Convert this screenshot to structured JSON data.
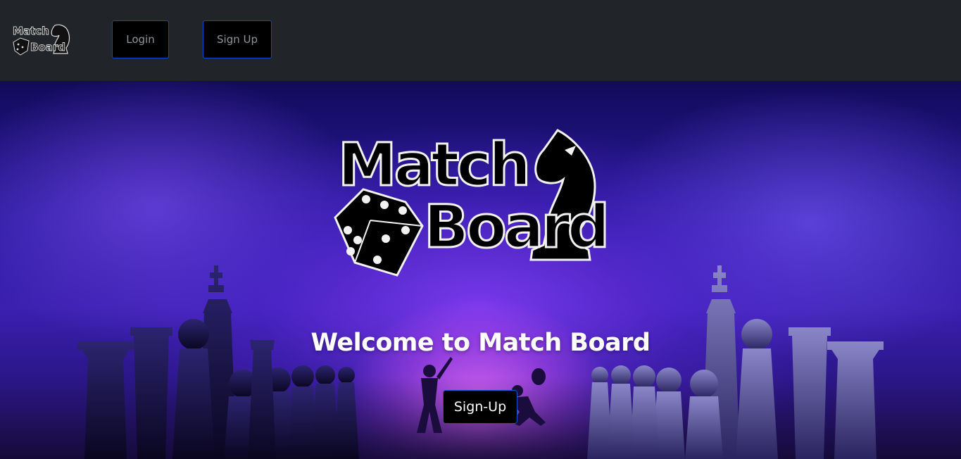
{
  "navbar": {
    "logo_alt": "Match Board",
    "login_label": "Login",
    "signup_label": "Sign Up"
  },
  "hero": {
    "logo_line1": "Match",
    "logo_line2": "Board",
    "heading": "Welcome to Match Board",
    "cta_label": "Sign-Up"
  },
  "colors": {
    "navbar_bg": "#212529",
    "button_border": "#0d47c8",
    "hero_accent": "#7b3ff2"
  },
  "icons": [
    "knight-icon",
    "dice-icon"
  ]
}
